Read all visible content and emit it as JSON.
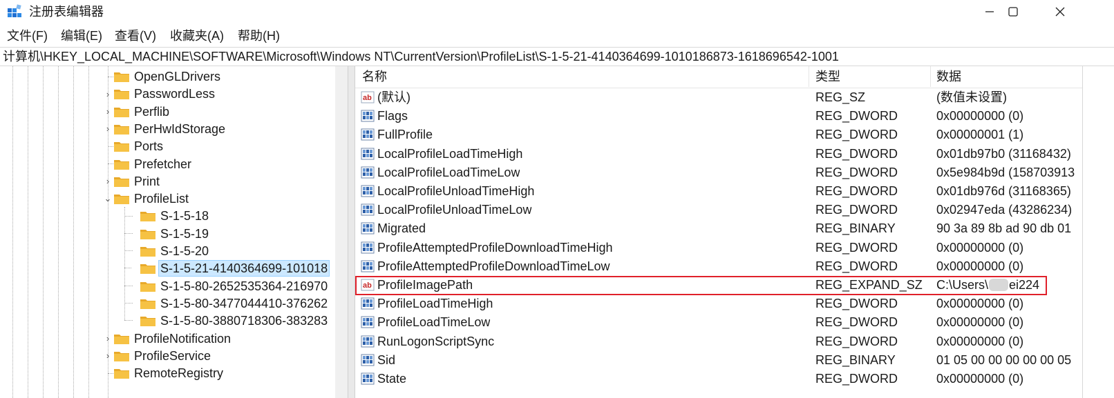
{
  "window": {
    "title": "注册表编辑器",
    "icon": "registry-editor-icon"
  },
  "window_controls": [
    "minimize-icon",
    "maximize-icon",
    "close-icon"
  ],
  "menu": [
    {
      "label": "文件(F)"
    },
    {
      "label": "编辑(E)"
    },
    {
      "label": "查看(V)"
    },
    {
      "label": "收藏夹(A)"
    },
    {
      "label": "帮助(H)"
    }
  ],
  "address": "计算机\\HKEY_LOCAL_MACHINE\\SOFTWARE\\Microsoft\\Windows NT\\CurrentVersion\\ProfileList\\S-1-5-21-4140364699-1010186873-1618696542-1001",
  "tree": [
    {
      "label": "OpenGLDrivers",
      "expander": ""
    },
    {
      "label": "PasswordLess",
      "expander": "›"
    },
    {
      "label": "Perflib",
      "expander": "›"
    },
    {
      "label": "PerHwIdStorage",
      "expander": "›"
    },
    {
      "label": "Ports",
      "expander": ""
    },
    {
      "label": "Prefetcher",
      "expander": ""
    },
    {
      "label": "Print",
      "expander": "›"
    },
    {
      "label": "ProfileList",
      "expander": "⌄"
    },
    {
      "label": "S-1-5-18",
      "expander": ""
    },
    {
      "label": "S-1-5-19",
      "expander": ""
    },
    {
      "label": "S-1-5-20",
      "expander": ""
    },
    {
      "label": "S-1-5-21-4140364699-101018",
      "expander": "",
      "selected": true
    },
    {
      "label": "S-1-5-80-2652535364-216970",
      "expander": ""
    },
    {
      "label": "S-1-5-80-3477044410-376262",
      "expander": ""
    },
    {
      "label": "S-1-5-80-3880718306-383283",
      "expander": ""
    },
    {
      "label": "ProfileNotification",
      "expander": "›"
    },
    {
      "label": "ProfileService",
      "expander": "›"
    },
    {
      "label": "RemoteRegistry",
      "expander": ""
    }
  ],
  "columns": {
    "name": "名称",
    "type": "类型",
    "data": "数据"
  },
  "values": [
    {
      "icon": "string-value-icon",
      "name": "(默认)",
      "type": "REG_SZ",
      "data": "(数值未设置)"
    },
    {
      "icon": "binary-value-icon",
      "name": "Flags",
      "type": "REG_DWORD",
      "data": "0x00000000 (0)"
    },
    {
      "icon": "binary-value-icon",
      "name": "FullProfile",
      "type": "REG_DWORD",
      "data": "0x00000001 (1)"
    },
    {
      "icon": "binary-value-icon",
      "name": "LocalProfileLoadTimeHigh",
      "type": "REG_DWORD",
      "data": "0x01db97b0 (31168432)"
    },
    {
      "icon": "binary-value-icon",
      "name": "LocalProfileLoadTimeLow",
      "type": "REG_DWORD",
      "data": "0x5e984b9d (158703913"
    },
    {
      "icon": "binary-value-icon",
      "name": "LocalProfileUnloadTimeHigh",
      "type": "REG_DWORD",
      "data": "0x01db976d (31168365)"
    },
    {
      "icon": "binary-value-icon",
      "name": "LocalProfileUnloadTimeLow",
      "type": "REG_DWORD",
      "data": "0x02947eda (43286234)"
    },
    {
      "icon": "binary-value-icon",
      "name": "Migrated",
      "type": "REG_BINARY",
      "data": "90 3a 89 8b ad 90 db 01"
    },
    {
      "icon": "binary-value-icon",
      "name": "ProfileAttemptedProfileDownloadTimeHigh",
      "type": "REG_DWORD",
      "data": "0x00000000 (0)"
    },
    {
      "icon": "binary-value-icon",
      "name": "ProfileAttemptedProfileDownloadTimeLow",
      "type": "REG_DWORD",
      "data": "0x00000000 (0)"
    },
    {
      "icon": "string-value-icon",
      "name": "ProfileImagePath",
      "type": "REG_EXPAND_SZ",
      "data_prefix": "C:\\Users\\",
      "data_suffix": "ei224",
      "highlighted": true
    },
    {
      "icon": "binary-value-icon",
      "name": "ProfileLoadTimeHigh",
      "type": "REG_DWORD",
      "data": "0x00000000 (0)"
    },
    {
      "icon": "binary-value-icon",
      "name": "ProfileLoadTimeLow",
      "type": "REG_DWORD",
      "data": "0x00000000 (0)"
    },
    {
      "icon": "binary-value-icon",
      "name": "RunLogonScriptSync",
      "type": "REG_DWORD",
      "data": "0x00000000 (0)"
    },
    {
      "icon": "binary-value-icon",
      "name": "Sid",
      "type": "REG_BINARY",
      "data": "01 05 00 00 00 00 00 05"
    },
    {
      "icon": "binary-value-icon",
      "name": "State",
      "type": "REG_DWORD",
      "data": "0x00000000 (0)"
    }
  ],
  "colors": {
    "selection": "#cce8ff",
    "highlight_border": "#e0202a",
    "folder": "#f6c244"
  }
}
